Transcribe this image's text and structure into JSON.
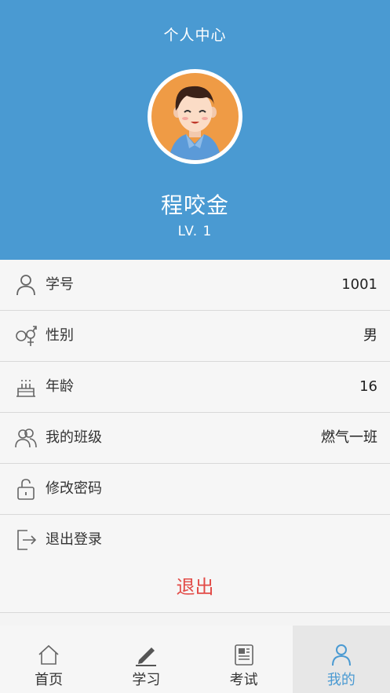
{
  "header": {
    "title": "个人中心",
    "name": "程咬金",
    "level": "LV. 1"
  },
  "profile": [
    {
      "icon": "person-icon",
      "label": "学号",
      "value": "1001"
    },
    {
      "icon": "gender-icon",
      "label": "性别",
      "value": "男"
    },
    {
      "icon": "cake-icon",
      "label": "年龄",
      "value": "16"
    },
    {
      "icon": "group-icon",
      "label": "我的班级",
      "value": "燃气一班"
    },
    {
      "icon": "unlock-icon",
      "label": "修改密码",
      "value": ""
    },
    {
      "icon": "exit-icon",
      "label": "退出登录",
      "value": ""
    }
  ],
  "logout_label": "退出",
  "tabs": [
    {
      "icon": "home-icon",
      "label": "首页",
      "active": false
    },
    {
      "icon": "pencil-icon",
      "label": "学习",
      "active": false
    },
    {
      "icon": "exam-icon",
      "label": "考试",
      "active": false
    },
    {
      "icon": "person-icon",
      "label": "我的",
      "active": true
    }
  ],
  "colors": {
    "primary": "#4a9ad2",
    "danger": "#e24b47",
    "avatar_bg": "#ef9b45"
  }
}
